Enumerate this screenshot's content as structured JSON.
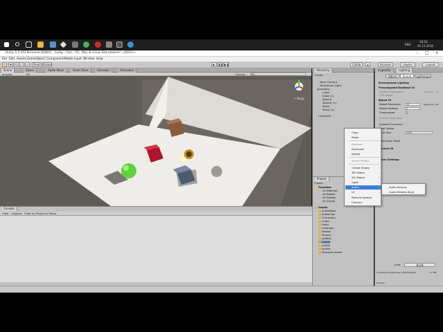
{
  "taskbar": {
    "lang": "ENG",
    "time": "16:03",
    "date": "01.11.2016"
  },
  "window": {
    "title": "Unity 5.5.0f3 Personal (64bit) - Lusky - fam - PC, Mac & Linux Standalone* <DX11>"
  },
  "menu": [
    "File",
    "Edit",
    "Assets",
    "GameObject",
    "Component",
    "Mobile Input",
    "Window",
    "Help"
  ],
  "toolbar": {
    "pivot": "Pivot",
    "global": "Global",
    "collab": "Collab",
    "account": "Account",
    "layers": "Layers",
    "layout": "Layout"
  },
  "tabs": {
    "scene": "Scene",
    "game": "Game",
    "audio_mixer": "Audio Mixer",
    "asset_store": "Asset Store",
    "animator": "Animator",
    "animation": "Animation",
    "hierarchy": "Hierarchy",
    "inspector": "Inspector",
    "lighting": "Lighting",
    "console": "Console",
    "project": "Project"
  },
  "scene_bar": {
    "shaded": "Shaded",
    "mode": "2D",
    "gizmos": "Gizmos",
    "search": "All"
  },
  "gizmo_label": "< Persp",
  "hierarchy": {
    "create": "Create",
    "items": [
      "Main Camera",
      "Directional Light",
      "geometry",
      "Cube",
      "Cube (1)",
      "Sphere",
      "Sphere (1)",
      "Plane",
      "Plane (1)",
      "Character"
    ]
  },
  "lighting": {
    "tabs": [
      "Object",
      "Scene",
      "Lightmaps"
    ],
    "environment": "Environment Lighting",
    "precomputed": "Precomputed Realtime GI",
    "realtime_res": "Realtime Resolution",
    "cpu_usage": "CPU Usage",
    "baked": "Baked GI",
    "baked_res": "Baked Resolution",
    "baked_res_val": "10",
    "baked_pad": "Baked Padding",
    "baked_pad_val": "2",
    "compressed": "Compressed",
    "indirect_res": "Indirect Resolution",
    "ao": "Ambient Occlusion",
    "final_gather": "Final Gather",
    "atlas_size": "Atlas Size",
    "atlas_val": "1024",
    "directional": "Directional Mode",
    "general": "General GI",
    "other": "Other Settings",
    "auto": "Auto",
    "build": "Build",
    "stats": "0 directional lightmaps: 1024x1024px",
    "stats_size": "2.7 MB",
    "texel_unit": "texels per unit",
    "preview": "Preview"
  },
  "console": {
    "clear": "Clear",
    "collapse": "Collapse",
    "clear_on_play": "Clear on Play",
    "error_pause": "Error Pause"
  },
  "project": {
    "create": "Create",
    "favorites": "Favorites",
    "fav_items": [
      "All Materials",
      "All Models",
      "All Prefabs",
      "All Scripts"
    ],
    "assets": "Assets",
    "asset_items": [
      "Animations",
      "AudioClips",
      "Characters",
      "Cubes",
      "Fonts",
      "materials",
      "Models",
      "Plugins",
      "prefabs",
      "scenes",
      "scripts",
      "Sprites",
      "Standard Assets"
    ]
  },
  "context_menu": {
    "items": [
      {
        "label": "Copy",
        "disabled": false
      },
      {
        "label": "Paste",
        "disabled": false
      },
      {
        "label": "Rename",
        "disabled": true
      },
      {
        "label": "Duplicate",
        "disabled": false
      },
      {
        "label": "Delete",
        "disabled": false
      },
      {
        "label": "Select Prefab",
        "disabled": true
      },
      {
        "label": "Create Empty",
        "disabled": false
      },
      {
        "label": "3D Object",
        "disabled": false
      },
      {
        "label": "2D Object",
        "disabled": false
      },
      {
        "label": "Light",
        "disabled": false
      },
      {
        "label": "Audio",
        "disabled": false
      },
      {
        "label": "UI",
        "disabled": false
      },
      {
        "label": "Particle System",
        "disabled": false
      },
      {
        "label": "Camera",
        "disabled": false
      }
    ],
    "highlighted": "Audio"
  },
  "submenu": {
    "items": [
      "Audio Source",
      "Audio Reverb Zone"
    ]
  },
  "colors": {
    "accent": "#3d7bd8",
    "sphere": "#5fd33a",
    "red_cube": "#b0142a",
    "brown_cube": "#8a5a38"
  }
}
